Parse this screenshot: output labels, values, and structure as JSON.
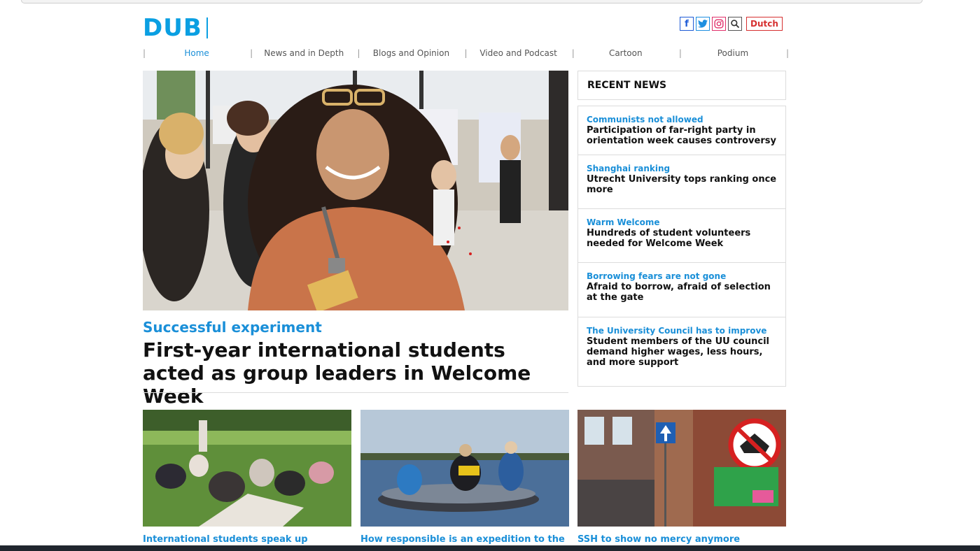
{
  "site": {
    "logo": "DUB",
    "lang_button": "Dutch"
  },
  "social": [
    {
      "icon": "facebook-icon",
      "glyph": "f"
    },
    {
      "icon": "twitter-icon",
      "glyph": "t"
    },
    {
      "icon": "instagram-icon",
      "glyph": "◎"
    },
    {
      "icon": "search-icon",
      "glyph": "⚲"
    }
  ],
  "nav": {
    "items": [
      "Home",
      "News and in Depth",
      "Blogs and Opinion",
      "Video and Podcast",
      "Cartoon",
      "Podium"
    ],
    "active": "Home"
  },
  "hero": {
    "kicker": "Successful experiment",
    "title": "First-year international students acted as group leaders in Welcome Week",
    "image": "students-welcome-week-photo"
  },
  "recent_news": {
    "heading": "RECENT NEWS",
    "items": [
      {
        "kicker": "Communists not allowed",
        "title": "Participation of far-right party in orientation week causes controversy"
      },
      {
        "kicker": "Shanghai ranking",
        "title": "Utrecht University tops ranking once more"
      },
      {
        "kicker": "Warm Welcome",
        "title": "Hundreds of student volunteers needed for Welcome Week"
      },
      {
        "kicker": "Borrowing fears are not gone",
        "title": "Afraid to borrow, afraid of selection at the gate"
      },
      {
        "kicker": "The University Council has to improve",
        "title": "Student members of the UU council demand higher wages, less hours, and more support"
      }
    ]
  },
  "cards": [
    {
      "caption": "International students speak up",
      "image": "students-on-grass-photo"
    },
    {
      "caption": "How responsible is an expedition to the",
      "image": "rubber-boat-photo"
    },
    {
      "caption": "SSH to show no mercy anymore",
      "image": "street-sign-photo"
    }
  ],
  "colors": {
    "brand": "#0a9fe2",
    "link": "#1a8fd8",
    "lang": "#d63030"
  }
}
